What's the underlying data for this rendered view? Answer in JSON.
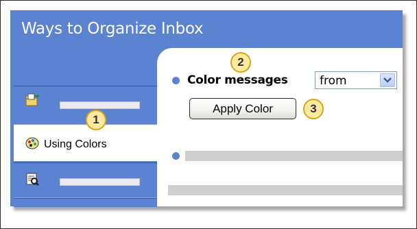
{
  "panel": {
    "title": "Ways to Organize Inbox"
  },
  "sidebar": {
    "items": [
      {
        "label": "",
        "icon": "folder-move-icon"
      },
      {
        "label": "Using Colors",
        "icon": "palette-icon"
      },
      {
        "label": "",
        "icon": "rules-icon"
      }
    ]
  },
  "content": {
    "color_messages_label": "Color messages",
    "select_value": "from",
    "apply_label": "Apply Color"
  },
  "callouts": [
    "1",
    "2",
    "3"
  ],
  "colors": {
    "panel_blue": "#5b83d1",
    "callout_fill": "#fde9a0",
    "callout_border": "#d8a51a"
  }
}
